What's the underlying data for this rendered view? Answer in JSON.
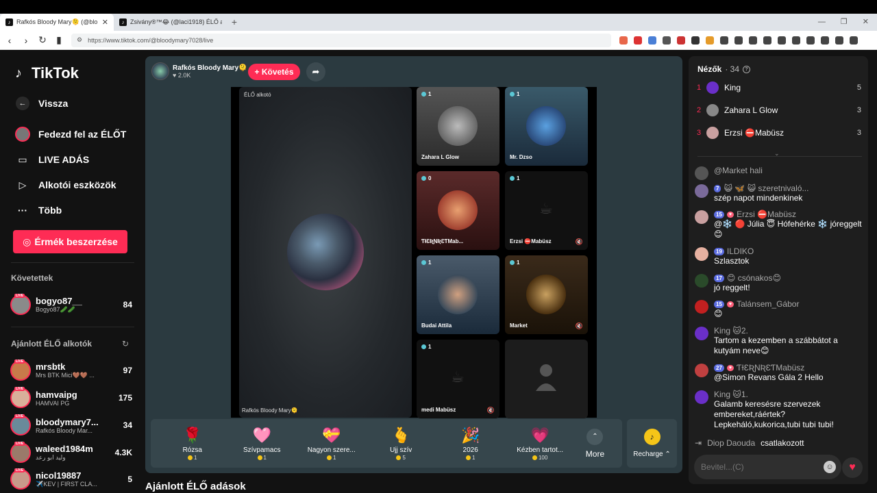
{
  "browser": {
    "tabs": [
      {
        "title": "Rafkós Bloody Mary🫠 (@blo",
        "active": true
      },
      {
        "title": "Zsivány®™😂 (@laci1918) ÉLŐ adás",
        "active": false
      }
    ],
    "url": "https://www.tiktok.com/@bloodymary7028/live"
  },
  "sidebar": {
    "logo": "TikTok",
    "back": "Vissza",
    "nav": [
      {
        "label": "Fedezd fel az ÉLŐT",
        "icon": "explore-live-icon"
      },
      {
        "label": "LIVE ADÁS",
        "icon": "video-camera-icon"
      },
      {
        "label": "Alkotói eszközök",
        "icon": "creator-tools-icon"
      },
      {
        "label": "Több",
        "icon": "more-dots-icon"
      }
    ],
    "coin_button": "Érmék beszerzése",
    "following_title": "Követettek",
    "following": [
      {
        "name": "bogyo87__",
        "sub": "Bogyó87🥒🥒",
        "count": "84"
      }
    ],
    "recommended_title": "Ajánlott ÉLŐ alkotók",
    "recommended": [
      {
        "name": "mrsbtk",
        "sub": "Mrs BTK Mici🤎🤎 ...",
        "count": "97"
      },
      {
        "name": "hamvaipg",
        "sub": "HAMVAI PG",
        "count": "175"
      },
      {
        "name": "bloodymary7...",
        "sub": "Rafkós Bloody Mar...",
        "count": "34"
      },
      {
        "name": "waleed1984m",
        "sub": "وليد ابو رعد",
        "count": "4.3K"
      },
      {
        "name": "nicol19887",
        "sub": "✈️KEV | FIRST CLA...",
        "count": "5"
      }
    ],
    "live_badge": "LIVE"
  },
  "stage": {
    "host_name": "Rafkós Bloody Mary🫠",
    "host_likes": "♥ 2.0K",
    "follow": "+ Követés",
    "main_label": "ÉLŐ alkotó",
    "main_footer": "Rafkós Bloody Mary🫠",
    "guests": [
      {
        "name": "Zahara L Glow",
        "count": "1",
        "muted": false
      },
      {
        "name": "Mr. Dzso",
        "count": "1",
        "muted": false
      },
      {
        "name": "ƬƗƐƦƝƦƐƬMab...",
        "count": "0",
        "muted": false
      },
      {
        "name": "Erzsi ⛔Mabüsz",
        "count": "1",
        "muted": true
      },
      {
        "name": "Budai Attila",
        "count": "1",
        "muted": false
      },
      {
        "name": "Market",
        "count": "1",
        "muted": true
      },
      {
        "name": "medi Mabüsz",
        "count": "1",
        "muted": true
      }
    ],
    "gifts": [
      {
        "name": "Rózsa",
        "price": "1",
        "icon": "🌹"
      },
      {
        "name": "Szívpamacs",
        "price": "1",
        "icon": "🩷"
      },
      {
        "name": "Nagyon szere...",
        "price": "1",
        "icon": "💝"
      },
      {
        "name": "Ujj szív",
        "price": "5",
        "icon": "🫰"
      },
      {
        "name": "2026",
        "price": "1",
        "icon": "🎉"
      },
      {
        "name": "Kézben tartot...",
        "price": "100",
        "icon": "💗"
      }
    ],
    "more": "More",
    "recharge": "Recharge ⌃"
  },
  "recommended_heading": "Ajánlott ÉLŐ adások",
  "panel": {
    "viewers_title": "Nézők",
    "viewers_count": "· 34",
    "viewers": [
      {
        "rank": "1",
        "name": "King",
        "score": "5",
        "color": "#6a2fc8"
      },
      {
        "rank": "2",
        "name": "Zahara L Glow",
        "score": "3",
        "color": "#888888"
      },
      {
        "rank": "3",
        "name": "Erzsi ⛔Mabüsz",
        "score": "3",
        "color": "#c9a0a0"
      }
    ],
    "messages": [
      {
        "user": "",
        "level": "",
        "text": "@Market hali",
        "color": "#555"
      },
      {
        "user": "😺 🦋 😺 szeretnivaló...",
        "level": "7",
        "text": "szép napot mindenkinek",
        "color": "#7a6a9a"
      },
      {
        "user": "Erzsi ⛔Mabüsz",
        "level": "15",
        "text": "@❄️ 🔴 Júlia 😇 Hófehérke ❄️ jóreggelt 😊",
        "color": "#c9a0a0"
      },
      {
        "user": "ILDIKO",
        "level": "19",
        "text": "Szlasztok",
        "color": "#e6b0a0"
      },
      {
        "user": "😊 csónakos😊",
        "level": "17",
        "text": "jó reggelt!",
        "color": "#2a4a2a"
      },
      {
        "user": "Talánsem_Gábor",
        "level": "15",
        "text": "😊",
        "color": "#c22020"
      },
      {
        "user": "King 🐱2.",
        "level": "",
        "text": "Tartom a kezemben a szábbátot a kutyám neve😊",
        "color": "#6a2fc8"
      },
      {
        "user": "ƬƗƐƦƝƦƐƬMabüsz",
        "level": "27",
        "text": "@Simon Revans Gála 2 Hello",
        "color": "#c04040"
      },
      {
        "user": "King 🐱1.",
        "level": "",
        "text": "Galamb keresésre szervezek embereket,ráértek? Lepkeháló,kukorica,tubi tubi tubi!",
        "color": "#6a2fc8"
      }
    ],
    "joined_user": "Diop Daouda",
    "joined_text": "csatlakozott",
    "input_placeholder": "Bevitel...(C)"
  }
}
